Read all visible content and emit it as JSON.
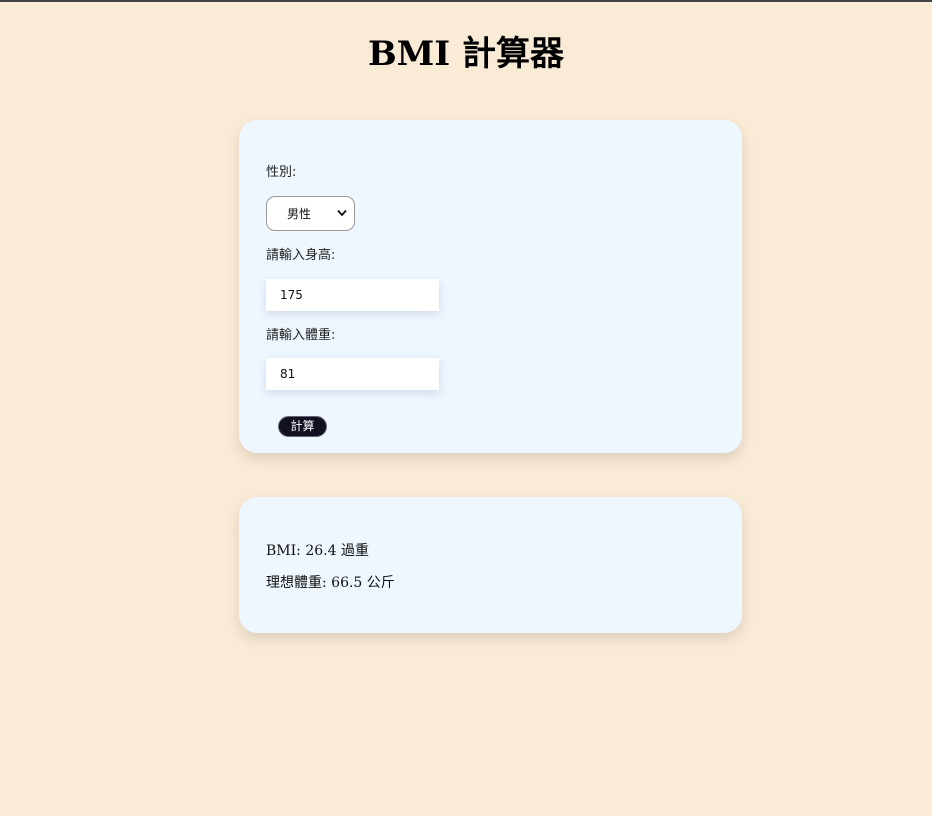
{
  "page": {
    "title": "BMI 計算器"
  },
  "form": {
    "gender_label": "性別:",
    "gender_selected": "男性",
    "height_label": "請輸入身高:",
    "height_value": "175",
    "weight_label": "請輸入體重:",
    "weight_value": "81",
    "calculate_label": "計算"
  },
  "result": {
    "bmi_text": "BMI: 26.4 過重",
    "ideal_weight_text": "理想體重: 66.5 公斤"
  },
  "colors": {
    "background": "#faebd7",
    "card": "#eef6fe",
    "button": "#111122"
  },
  "icons": {
    "select_arrow": "chevron-down-icon"
  }
}
